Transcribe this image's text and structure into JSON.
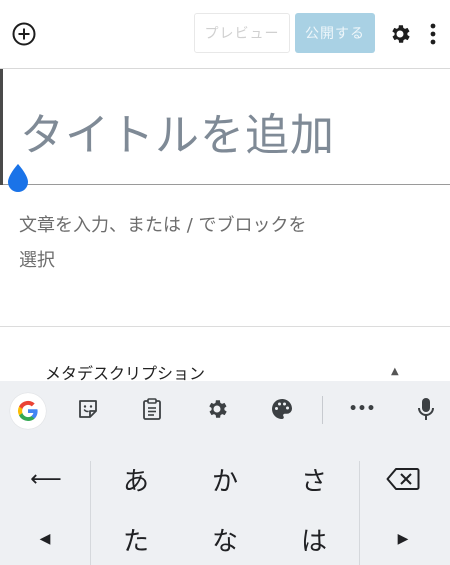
{
  "toolbar": {
    "add_icon": "plus-circle-icon",
    "preview_label": "プレビュー",
    "publish_label": "公開する",
    "settings_icon": "gear-icon",
    "more_icon": "vertical-ellipsis-icon"
  },
  "editor": {
    "title_placeholder": "タイトルを追加",
    "body_placeholder": "文章を入力、または / でブロックを選択"
  },
  "meta": {
    "label": "メタデスクリプション",
    "toggle_symbol": "▲"
  },
  "keyboard_suggestions": {
    "items": [
      "google-logo-icon",
      "sticker-icon",
      "clipboard-icon",
      "gear-icon",
      "palette-icon",
      "more-horizontal-icon",
      "microphone-icon"
    ],
    "google_letter": "G",
    "more_symbol": "•••"
  },
  "keyboard": {
    "row1": [
      "あ",
      "か",
      "さ"
    ],
    "row2": [
      "た",
      "な",
      "は"
    ],
    "undo_symbol": "⟵",
    "backspace_icon": "backspace-icon",
    "left_symbol": "◀",
    "right_symbol": "▶"
  },
  "colors": {
    "publish_bg": "#a9d1e4",
    "handle_blue": "#1a73e8",
    "keyboard_bg": "#eef0f3"
  }
}
